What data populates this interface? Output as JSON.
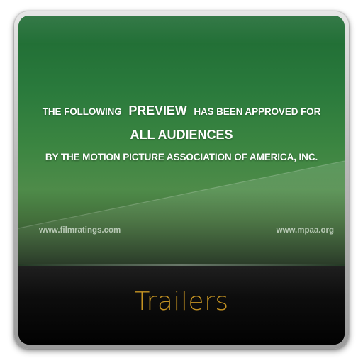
{
  "rating_card": {
    "line1_prefix": "THE FOLLOWING",
    "line1_emphasis": "PREVIEW",
    "line1_suffix": "HAS BEEN APPROVED FOR",
    "line2": "ALL AUDIENCES",
    "line3": "BY THE MOTION PICTURE ASSOCIATION OF AMERICA, INC.",
    "url_left": "www.filmratings.com",
    "url_right": "www.mpaa.org"
  },
  "app": {
    "title": "Trailers"
  },
  "colors": {
    "card_green": "#2a7a3c",
    "title_gold": "#c59322",
    "background": "#ffffff"
  },
  "icons": [
    "app-icon-frame"
  ]
}
